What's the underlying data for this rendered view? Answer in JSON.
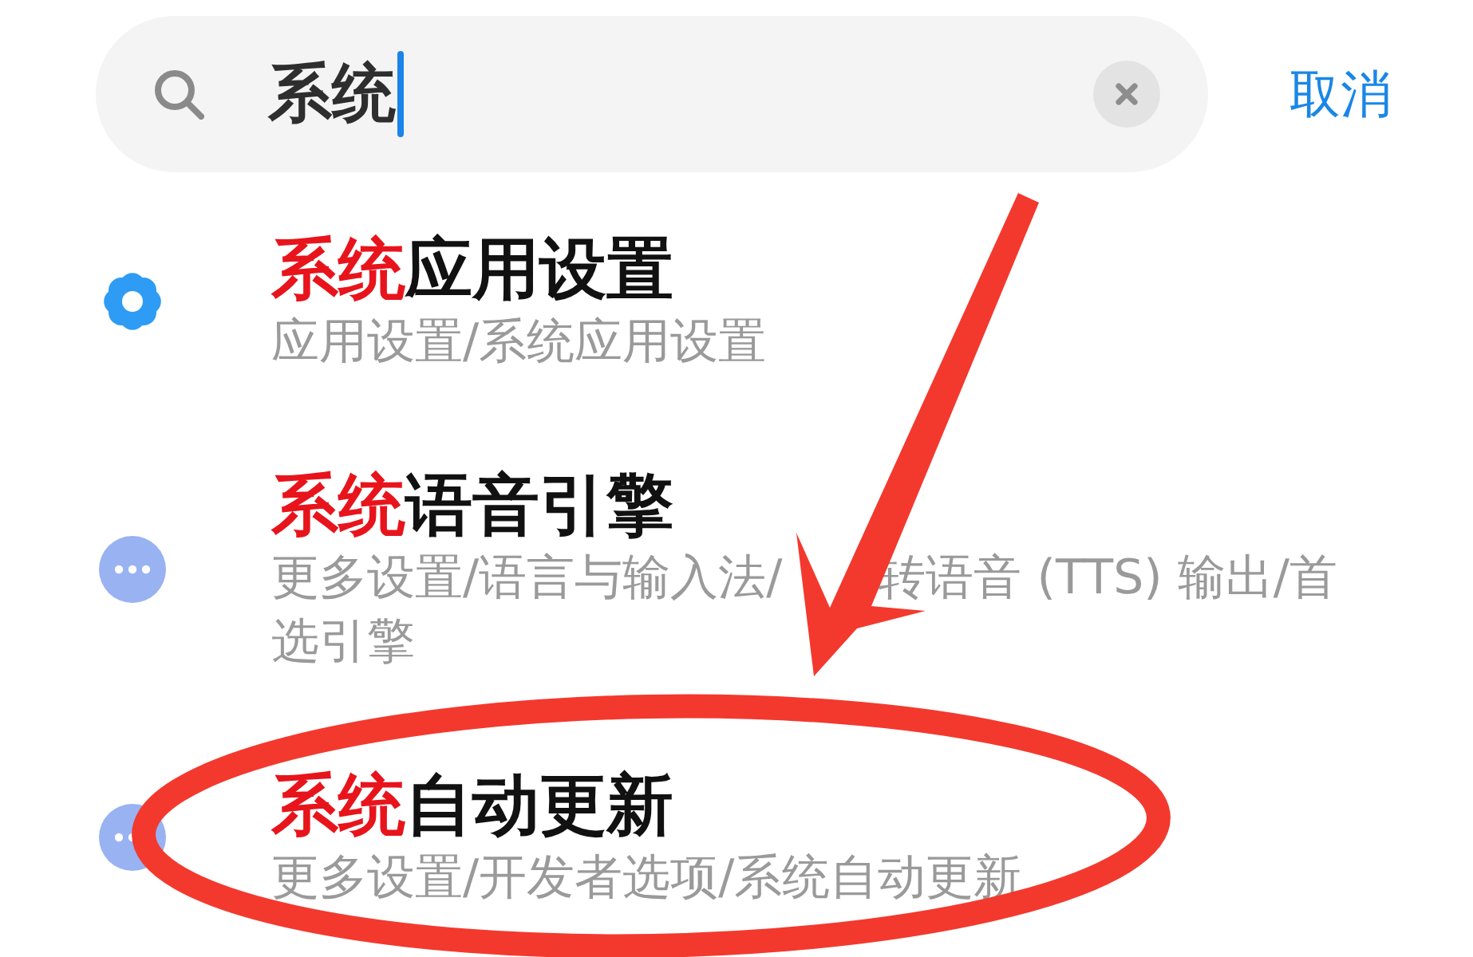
{
  "search": {
    "query": "系统",
    "cancel": "取消"
  },
  "results": [
    {
      "kind": "settings",
      "title_match": "系统",
      "title_rest": "应用设置",
      "path_parts": [
        "应用设置/系统应用设置"
      ]
    },
    {
      "kind": "more",
      "title_match": "系统",
      "title_rest": "语音引擎",
      "path_parts": [
        "更多设置/语言与输入法/",
        "转语音 (TTS) 输出/首选引擎"
      ]
    },
    {
      "kind": "more",
      "title_match": "系统",
      "title_rest": "自动更新",
      "path_parts": [
        "更多设置/开发者选项/系统自动更新"
      ]
    }
  ]
}
